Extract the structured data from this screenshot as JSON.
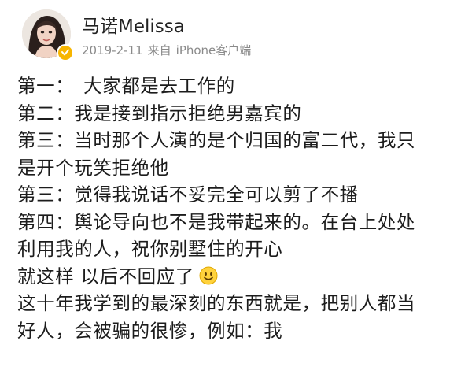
{
  "post": {
    "author": {
      "name": "马诺Melissa"
    },
    "meta": {
      "date": "2019-2-11",
      "source_prefix": "来自",
      "source": "iPhone客户端"
    },
    "lines": [
      {
        "label": "第一：",
        "text": "大家都是去工作的"
      },
      {
        "label": "第二：",
        "text": "我是接到指示拒绝男嘉宾的"
      },
      {
        "label": "第三：",
        "text": "当时那个人演的是个归国的富二代，我只"
      },
      {
        "label": "",
        "text": "是开个玩笑拒绝他"
      },
      {
        "label": "第三：",
        "text": "觉得我说话不妥完全可以剪了不播"
      },
      {
        "label": "第四：",
        "text": "舆论导向也不是我带起来的。在台上处处"
      },
      {
        "label": "",
        "text": "利用我的人，祝你别墅住的开心"
      },
      {
        "label": "",
        "text": "就这样 以后不回应了"
      },
      {
        "label": "",
        "text": "这十年我学到的最深刻的东西就是，把别人都当"
      },
      {
        "label": "",
        "text": "好人，会被骗的很惨，例如：我"
      }
    ],
    "emoji": "smile-icon"
  },
  "colors": {
    "badge": "#f7b500",
    "meta_text": "#8a8a8a",
    "body_text": "#1c1c1c"
  }
}
